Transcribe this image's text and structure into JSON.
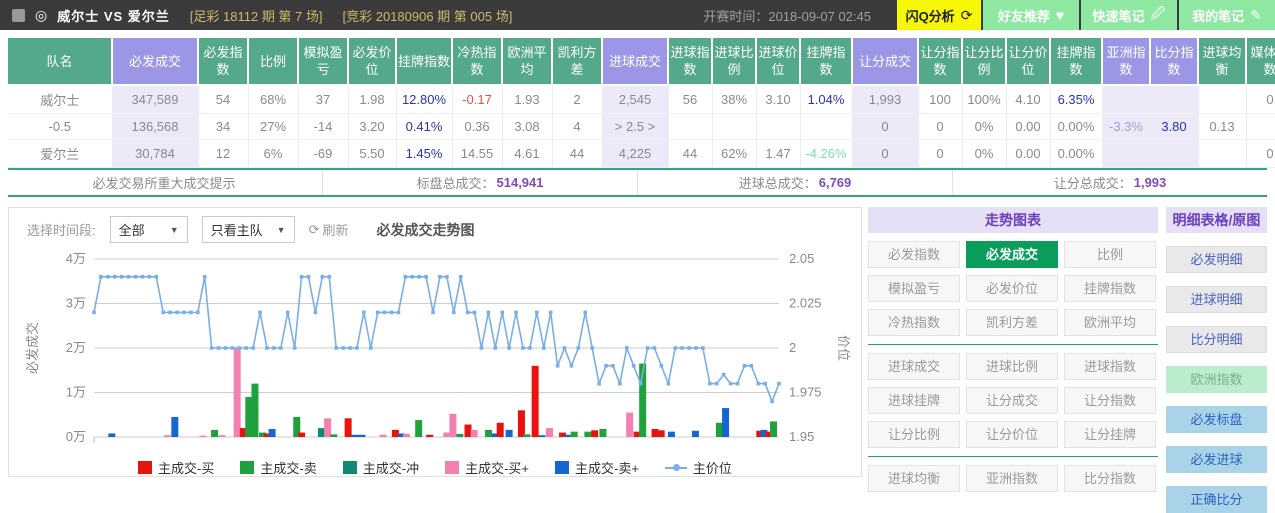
{
  "topbar": {
    "match_title": "威尔士  VS 爱尔兰",
    "tag1": "[足彩 18112 期 第 7 场]",
    "tag2": "[竞彩 20180906 期 第 005 场]",
    "kickoff": "开赛时间：2018-09-07 02:45",
    "buttons": [
      {
        "label": "闪Q分析",
        "style": "yellow",
        "icon": "flash-analysis-icon",
        "glyph": "⟳"
      },
      {
        "label": "好友推荐",
        "style": "green",
        "icon": "heart-icon",
        "glyph": "♥"
      },
      {
        "label": "快速笔记",
        "style": "green",
        "icon": "edit-note-icon",
        "glyph": "🖉"
      },
      {
        "label": "我的笔记",
        "style": "green",
        "icon": "pencil-icon",
        "glyph": "✎"
      }
    ]
  },
  "table": {
    "columns": [
      {
        "label": "队名",
        "hl": false
      },
      {
        "label": "必发成交",
        "hl": true
      },
      {
        "label": "必发指数",
        "hl": false
      },
      {
        "label": "比例",
        "hl": false
      },
      {
        "label": "模拟盈亏",
        "hl": false
      },
      {
        "label": "必发价位",
        "hl": false
      },
      {
        "label": "挂牌指数",
        "hl": false
      },
      {
        "label": "冷热指数",
        "hl": false
      },
      {
        "label": "欧洲平均",
        "hl": false
      },
      {
        "label": "凯利方差",
        "hl": false
      },
      {
        "label": "进球成交",
        "hl": true
      },
      {
        "label": "进球指数",
        "hl": false
      },
      {
        "label": "进球比例",
        "hl": false
      },
      {
        "label": "进球价位",
        "hl": false
      },
      {
        "label": "挂牌指数",
        "hl": false
      },
      {
        "label": "让分成交",
        "hl": true
      },
      {
        "label": "让分指数",
        "hl": false
      },
      {
        "label": "让分比例",
        "hl": false
      },
      {
        "label": "让分价位",
        "hl": false
      },
      {
        "label": "挂牌指数",
        "hl": false
      },
      {
        "label": "亚洲指数",
        "hl": true
      },
      {
        "label": "比分指数",
        "hl": true
      },
      {
        "label": "进球均衡",
        "hl": false
      },
      {
        "label": "媒体指数",
        "hl": false
      }
    ],
    "rows": [
      [
        "威尔士",
        "347,589",
        "54",
        "68%",
        "37",
        "1.98",
        {
          "v": "12.80%",
          "c": "blue"
        },
        {
          "v": "-0.17",
          "c": "red"
        },
        "1.93",
        "2",
        "2,545",
        "56",
        "38%",
        "3.10",
        {
          "v": "1.04%",
          "c": "blue"
        },
        "1,993",
        "100",
        "100%",
        "4.10",
        {
          "v": "6.35%",
          "c": "blue"
        },
        "",
        "",
        "",
        "0"
      ],
      [
        "-0.5",
        "136,568",
        "34",
        "27%",
        "-14",
        "3.20",
        {
          "v": "0.41%",
          "c": "blue"
        },
        "0.36",
        "3.08",
        "4",
        "> 2.5 >",
        "",
        "",
        "",
        "",
        "0",
        "0",
        "0%",
        "0.00",
        "0.00%",
        {
          "v": "-3.3%",
          "c": "lilac"
        },
        {
          "v": "3.80",
          "c": "navy"
        },
        "0.13",
        ""
      ],
      [
        "爱尔兰",
        "30,784",
        "12",
        "6%",
        "-69",
        "5.50",
        {
          "v": "1.45%",
          "c": "blue"
        },
        "14.55",
        "4.61",
        "44",
        "4,225",
        "44",
        "62%",
        "1.47",
        {
          "v": "-4.26%",
          "c": "mint"
        },
        "0",
        "0",
        "0%",
        "0.00",
        "0.00%",
        "",
        "",
        "",
        "0"
      ]
    ],
    "summary": [
      {
        "label": "必发交易所重大成交提示",
        "value": ""
      },
      {
        "label": "标盘总成交：",
        "value": "514,941"
      },
      {
        "label": "进球总成交：",
        "value": "6,769"
      },
      {
        "label": "让分总成交：",
        "value": "1,993"
      }
    ]
  },
  "chart_controls": {
    "time_label": "选择时间段:",
    "time_value": "全部",
    "team_value": "只看主队",
    "refresh_label": "刷新",
    "title": "必发成交走势图"
  },
  "chart_data": {
    "type": "bar+line",
    "title": "必发成交走势图",
    "y_left": {
      "label": "必发成交",
      "ticks": [
        "4万",
        "3万",
        "2万",
        "1万",
        "0万"
      ],
      "min": 0,
      "max": 4,
      "unit": "万"
    },
    "y_right": {
      "label": "价位",
      "ticks": [
        "2.05",
        "2.025",
        "2",
        "1.975",
        "1.95"
      ],
      "min": 1.95,
      "max": 2.05
    },
    "colors": {
      "buy": "#e8120e",
      "sell": "#1fa23d",
      "rush": "#118a73",
      "buy_plus": "#f480b1",
      "sell_plus": "#1467d2",
      "price": "#7aaee8"
    },
    "legend": [
      {
        "name": "主成交-买",
        "key": "buy"
      },
      {
        "name": "主成交-卖",
        "key": "sell"
      },
      {
        "name": "主成交-冲",
        "key": "rush"
      },
      {
        "name": "主成交-买+",
        "key": "buy_plus"
      },
      {
        "name": "主成交-卖+",
        "key": "sell_plus"
      },
      {
        "name": "主价位",
        "key": "price",
        "type": "line"
      }
    ],
    "bars": [
      {
        "x": 0.026,
        "h": 0.08,
        "k": "sell_plus"
      },
      {
        "x": 0.107,
        "h": 0.04,
        "k": "buy_plus"
      },
      {
        "x": 0.118,
        "h": 0.45,
        "k": "sell_plus"
      },
      {
        "x": 0.159,
        "h": 0.03,
        "k": "buy_plus"
      },
      {
        "x": 0.176,
        "h": 0.16,
        "k": "sell"
      },
      {
        "x": 0.187,
        "h": 0.04,
        "k": "buy_plus"
      },
      {
        "x": 0.209,
        "h": 2.0,
        "k": "buy_plus"
      },
      {
        "x": 0.218,
        "h": 0.2,
        "k": "buy"
      },
      {
        "x": 0.226,
        "h": 0.9,
        "k": "sell"
      },
      {
        "x": 0.235,
        "h": 1.2,
        "k": "sell"
      },
      {
        "x": 0.246,
        "h": 0.1,
        "k": "sell"
      },
      {
        "x": 0.253,
        "h": 0.08,
        "k": "buy"
      },
      {
        "x": 0.26,
        "h": 0.18,
        "k": "sell_plus"
      },
      {
        "x": 0.296,
        "h": 0.45,
        "k": "sell"
      },
      {
        "x": 0.303,
        "h": 0.1,
        "k": "buy"
      },
      {
        "x": 0.332,
        "h": 0.2,
        "k": "rush"
      },
      {
        "x": 0.341,
        "h": 0.42,
        "k": "buy_plus"
      },
      {
        "x": 0.35,
        "h": 0.06,
        "k": "sell"
      },
      {
        "x": 0.371,
        "h": 0.42,
        "k": "buy"
      },
      {
        "x": 0.381,
        "h": 0.05,
        "k": "sell_plus"
      },
      {
        "x": 0.391,
        "h": 0.05,
        "k": "sell_plus"
      },
      {
        "x": 0.422,
        "h": 0.05,
        "k": "buy_plus"
      },
      {
        "x": 0.44,
        "h": 0.16,
        "k": "buy"
      },
      {
        "x": 0.449,
        "h": 0.08,
        "k": "sell_plus"
      },
      {
        "x": 0.456,
        "h": 0.07,
        "k": "buy_plus"
      },
      {
        "x": 0.474,
        "h": 0.38,
        "k": "sell"
      },
      {
        "x": 0.49,
        "h": 0.05,
        "k": "buy"
      },
      {
        "x": 0.515,
        "h": 0.1,
        "k": "buy_plus"
      },
      {
        "x": 0.524,
        "h": 0.52,
        "k": "buy_plus"
      },
      {
        "x": 0.534,
        "h": 0.07,
        "k": "sell"
      },
      {
        "x": 0.546,
        "h": 0.28,
        "k": "buy"
      },
      {
        "x": 0.555,
        "h": 0.16,
        "k": "buy_plus"
      },
      {
        "x": 0.576,
        "h": 0.16,
        "k": "sell"
      },
      {
        "x": 0.585,
        "h": 0.08,
        "k": "sell_plus"
      },
      {
        "x": 0.593,
        "h": 0.32,
        "k": "buy"
      },
      {
        "x": 0.606,
        "h": 0.16,
        "k": "sell_plus"
      },
      {
        "x": 0.624,
        "h": 0.6,
        "k": "buy"
      },
      {
        "x": 0.632,
        "h": 0.06,
        "k": "sell"
      },
      {
        "x": 0.644,
        "h": 1.6,
        "k": "buy"
      },
      {
        "x": 0.654,
        "h": 0.04,
        "k": "sell_plus"
      },
      {
        "x": 0.665,
        "h": 0.2,
        "k": "buy_plus"
      },
      {
        "x": 0.684,
        "h": 0.1,
        "k": "buy"
      },
      {
        "x": 0.691,
        "h": 0.05,
        "k": "sell_plus"
      },
      {
        "x": 0.701,
        "h": 0.12,
        "k": "sell"
      },
      {
        "x": 0.721,
        "h": 0.12,
        "k": "sell"
      },
      {
        "x": 0.731,
        "h": 0.15,
        "k": "buy"
      },
      {
        "x": 0.743,
        "h": 0.18,
        "k": "sell"
      },
      {
        "x": 0.782,
        "h": 0.55,
        "k": "buy_plus"
      },
      {
        "x": 0.793,
        "h": 0.12,
        "k": "buy"
      },
      {
        "x": 0.801,
        "h": 1.65,
        "k": "sell"
      },
      {
        "x": 0.819,
        "h": 0.18,
        "k": "buy"
      },
      {
        "x": 0.828,
        "h": 0.15,
        "k": "buy"
      },
      {
        "x": 0.843,
        "h": 0.12,
        "k": "sell_plus"
      },
      {
        "x": 0.878,
        "h": 0.14,
        "k": "sell_plus"
      },
      {
        "x": 0.913,
        "h": 0.32,
        "k": "sell"
      },
      {
        "x": 0.922,
        "h": 0.65,
        "k": "sell_plus"
      },
      {
        "x": 0.972,
        "h": 0.14,
        "k": "buy"
      },
      {
        "x": 0.978,
        "h": 0.16,
        "k": "sell_plus"
      },
      {
        "x": 0.985,
        "h": 0.12,
        "k": "buy"
      },
      {
        "x": 0.992,
        "h": 0.35,
        "k": "sell"
      }
    ],
    "price": [
      2.02,
      2.04,
      2.04,
      2.04,
      2.04,
      2.04,
      2.04,
      2.04,
      2.04,
      2.04,
      2.02,
      2.02,
      2.02,
      2.02,
      2.02,
      2.02,
      2.04,
      2.0,
      2.0,
      2.0,
      2.0,
      2.0,
      2.0,
      2.0,
      2.02,
      2.0,
      2.0,
      2.0,
      2.02,
      2.0,
      2.04,
      2.04,
      2.02,
      2.04,
      2.04,
      2.0,
      2.0,
      2.0,
      2.0,
      2.02,
      2.0,
      2.02,
      2.02,
      2.02,
      2.02,
      2.04,
      2.04,
      2.04,
      2.04,
      2.02,
      2.04,
      2.04,
      2.02,
      2.04,
      2.02,
      2.02,
      2.0,
      2.02,
      2.0,
      2.02,
      2.0,
      2.02,
      2.0,
      2.0,
      2.02,
      2.0,
      2.02,
      1.99,
      2.0,
      1.99,
      2.0,
      2.02,
      2.0,
      1.98,
      1.99,
      1.99,
      1.98,
      2.0,
      1.99,
      1.98,
      2.0,
      2.0,
      1.99,
      1.98,
      2.0,
      2.0,
      2.0,
      2.0,
      2.0,
      1.98,
      1.98,
      1.985,
      1.98,
      1.98,
      1.99,
      1.99,
      1.98,
      1.98,
      1.97,
      1.98
    ]
  },
  "trend_panel": {
    "title": "走势图表",
    "groups": [
      [
        {
          "label": "必发指数"
        },
        {
          "label": "必发成交",
          "selected": true
        },
        {
          "label": "比例"
        },
        {
          "label": "模拟盈亏"
        },
        {
          "label": "必发价位"
        },
        {
          "label": "挂牌指数"
        },
        {
          "label": "冷热指数"
        },
        {
          "label": "凯利方差"
        },
        {
          "label": "欧洲平均"
        }
      ],
      [
        {
          "label": "进球成交"
        },
        {
          "label": "进球比例"
        },
        {
          "label": "进球指数"
        },
        {
          "label": "进球挂牌"
        },
        {
          "label": "让分成交"
        },
        {
          "label": "让分指数"
        },
        {
          "label": "让分比例"
        },
        {
          "label": "让分价位"
        },
        {
          "label": "让分挂牌"
        }
      ],
      [
        {
          "label": "进球均衡"
        },
        {
          "label": "亚洲指数"
        },
        {
          "label": "比分指数"
        }
      ]
    ]
  },
  "detail_panel": {
    "title": "明细表格/原图",
    "buttons": [
      {
        "label": "必发明细",
        "style": "gray"
      },
      {
        "label": "进球明细",
        "style": "gray"
      },
      {
        "label": "比分明细",
        "style": "gray"
      },
      {
        "label": "欧洲指数",
        "style": "green"
      },
      {
        "label": "必发标盘",
        "style": "blue"
      },
      {
        "label": "必发进球",
        "style": "blue"
      },
      {
        "label": "正确比分",
        "style": "blue"
      }
    ]
  }
}
